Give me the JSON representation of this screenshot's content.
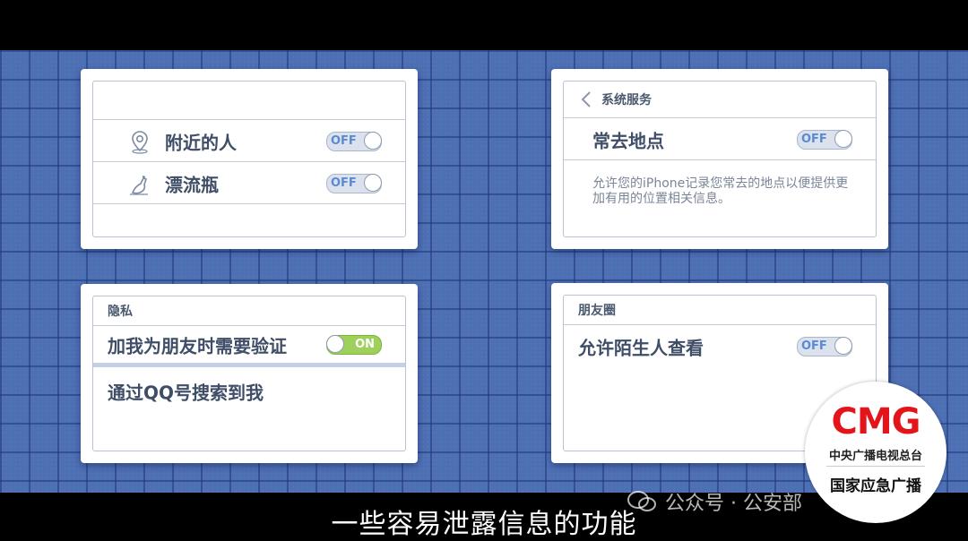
{
  "cards": {
    "nearby": {
      "items": [
        {
          "label": "附近的人",
          "icon": "location-pin-icon",
          "toggle": "OFF"
        },
        {
          "label": "漂流瓶",
          "icon": "bottle-icon",
          "toggle": "OFF"
        }
      ]
    },
    "system": {
      "header": "系统服务",
      "item": {
        "label": "常去地点",
        "toggle": "OFF"
      },
      "description": "允许您的iPhone记录您常去的地点以便提供更加有用的位置相关信息。"
    },
    "privacy": {
      "header": "隐私",
      "verify": {
        "label": "加我为朋友时需要验证",
        "toggle": "ON"
      },
      "search": {
        "label": "通过QQ号搜索到我"
      }
    },
    "moments": {
      "header": "朋友圈",
      "item": {
        "label": "允许陌生人查看",
        "toggle": "OFF"
      }
    }
  },
  "subtitle": "一些容易泄露信息的功能",
  "watermark": "公众号 · 公安部",
  "logo": {
    "brand": "CMG",
    "line1": "中央广播电视总台",
    "line2": "国家应急广播"
  },
  "colors": {
    "background": "#4d6fb4",
    "toggle_on": "#9fd05c",
    "toggle_off_text": "#5b8ad0",
    "logo_red": "#e4141b"
  }
}
